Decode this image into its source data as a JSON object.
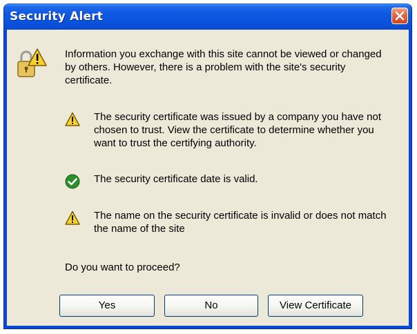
{
  "window": {
    "title": "Security Alert"
  },
  "dialog": {
    "intro": "Information you exchange with this site cannot be viewed or changed by others. However, there is a problem with the site's security certificate.",
    "items": [
      {
        "icon": "warning-icon",
        "text": "The security certificate was issued by a company you have not chosen to trust. View the certificate to determine whether you want to trust the certifying authority."
      },
      {
        "icon": "checkmark-icon",
        "text": "The security certificate date is valid."
      },
      {
        "icon": "warning-icon",
        "text": "The name on the security certificate is invalid or does not match the name of the site"
      }
    ],
    "question": "Do you want to proceed?"
  },
  "buttons": {
    "yes": "Yes",
    "no": "No",
    "view_certificate": "View Certificate"
  },
  "colors": {
    "titlebar": "#0a52dd",
    "dialog_background": "#ece9d8",
    "warning": "#f8d030",
    "valid": "#2a8f2a",
    "close_button": "#d4441e"
  }
}
